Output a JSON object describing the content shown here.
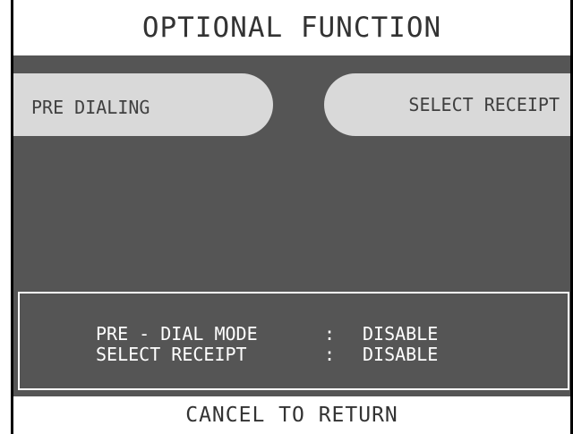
{
  "title": "OPTIONAL FUNCTION",
  "menu": {
    "left_label": "PRE DIALING",
    "right_label": "SELECT RECEIPT"
  },
  "status": {
    "rows": [
      {
        "label": "PRE - DIAL MODE",
        "separator": ":",
        "value": "DISABLE"
      },
      {
        "label": "SELECT RECEIPT",
        "separator": ":",
        "value": "DISABLE"
      }
    ]
  },
  "footer": "CANCEL TO RETURN",
  "colors": {
    "panel": "#555555",
    "button": "#d9d9d9",
    "text_dark": "#333333",
    "text_light": "#ffffff"
  }
}
